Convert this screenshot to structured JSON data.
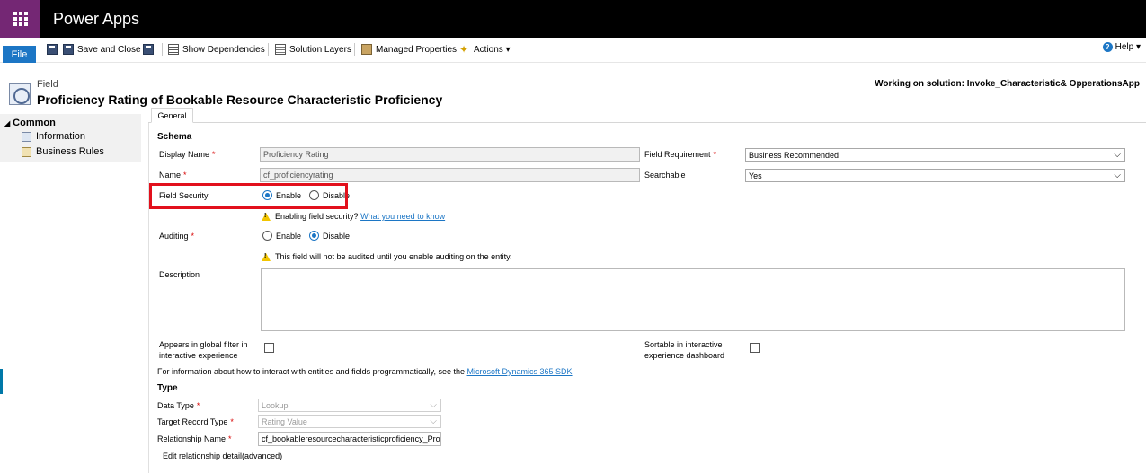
{
  "app": {
    "title": "Power Apps"
  },
  "ribbon": {
    "file": "File",
    "save_and_close": "Save and Close",
    "show_dependencies": "Show Dependencies",
    "solution_layers": "Solution Layers",
    "managed_properties": "Managed Properties",
    "actions": "Actions ▾",
    "help": "Help ▾"
  },
  "header": {
    "breadcrumb": "Field",
    "title": "Proficiency Rating of Bookable Resource Characteristic Proficiency",
    "solution": "Working on solution: Invoke_Characteristic& OpperationsApp"
  },
  "nav": {
    "group": "Common",
    "items": [
      {
        "label": "Information",
        "icon": "information-icon"
      },
      {
        "label": "Business Rules",
        "icon": "business-rules-icon"
      }
    ]
  },
  "tabs": [
    {
      "label": "General"
    }
  ],
  "form": {
    "schema_heading": "Schema",
    "display_name": {
      "label": "Display Name",
      "value": "Proficiency Rating"
    },
    "name": {
      "label": "Name",
      "value": "cf_proficiencyrating"
    },
    "field_requirement": {
      "label": "Field Requirement",
      "value": "Business Recommended"
    },
    "searchable": {
      "label": "Searchable",
      "value": "Yes"
    },
    "field_security": {
      "label": "Field Security",
      "enable": "Enable",
      "disable": "Disable",
      "selected": "Enable"
    },
    "field_security_warning": {
      "text": "Enabling field security?",
      "link": "What you need to know"
    },
    "auditing": {
      "label": "Auditing",
      "enable": "Enable",
      "disable": "Disable",
      "selected": "Disable"
    },
    "auditing_warning": "This field will not be audited until you enable auditing on the entity.",
    "description": {
      "label": "Description",
      "value": ""
    },
    "global_filter": {
      "label_line1": "Appears in global filter in",
      "label_line2": "interactive experience",
      "checked": false
    },
    "sortable": {
      "label_line1": "Sortable in interactive",
      "label_line2": "experience dashboard",
      "checked": false
    },
    "sdk_text": "For information about how to interact with entities and fields programmatically, see the",
    "sdk_link": "Microsoft Dynamics 365 SDK",
    "type_heading": "Type",
    "data_type": {
      "label": "Data Type",
      "value": "Lookup"
    },
    "target_record_type": {
      "label": "Target Record Type",
      "value": "Rating Value"
    },
    "relationship_name": {
      "label": "Relationship Name",
      "value": "cf_bookableresourcecharacteristicproficiency_Prof"
    },
    "edit_relationship": "Edit relationship detail(advanced)"
  },
  "colors": {
    "accent": "#1c76c5",
    "brand": "#742774",
    "highlight": "#e2101c"
  }
}
